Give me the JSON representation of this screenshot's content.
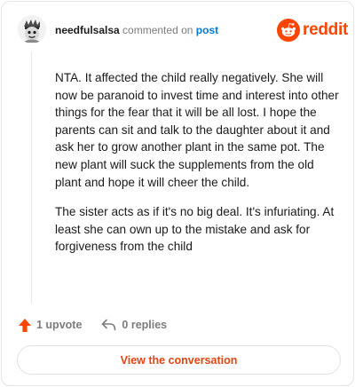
{
  "header": {
    "username": "needfulsalsa",
    "action_text": "commented on",
    "post_link": "post",
    "brand": "reddit"
  },
  "comment": {
    "paragraphs": [
      "NTA. It affected the child really negatively. She will now be paranoid to invest time and interest into other things for the fear that it will be all lost. I hope the parents can sit and talk to the daughter about it and ask her to grow another plant in the same pot. The new plant will suck the supplements from the old plant and hope it will cheer the child.",
      "The sister acts as if it's no big deal. It's infuriating. At least she can own up to the mistake and ask for forgiveness from the child"
    ]
  },
  "actions": {
    "upvote_label": "1 upvote",
    "replies_label": "0 replies"
  },
  "footer": {
    "view_button_label": "View the conversation"
  },
  "colors": {
    "brand": "#ff4500",
    "link": "#0079d3",
    "muted": "#7c7c7c"
  },
  "icons": [
    "avatar-image",
    "reddit-snoo-icon",
    "upvote-arrow-icon",
    "reply-arrow-icon"
  ]
}
